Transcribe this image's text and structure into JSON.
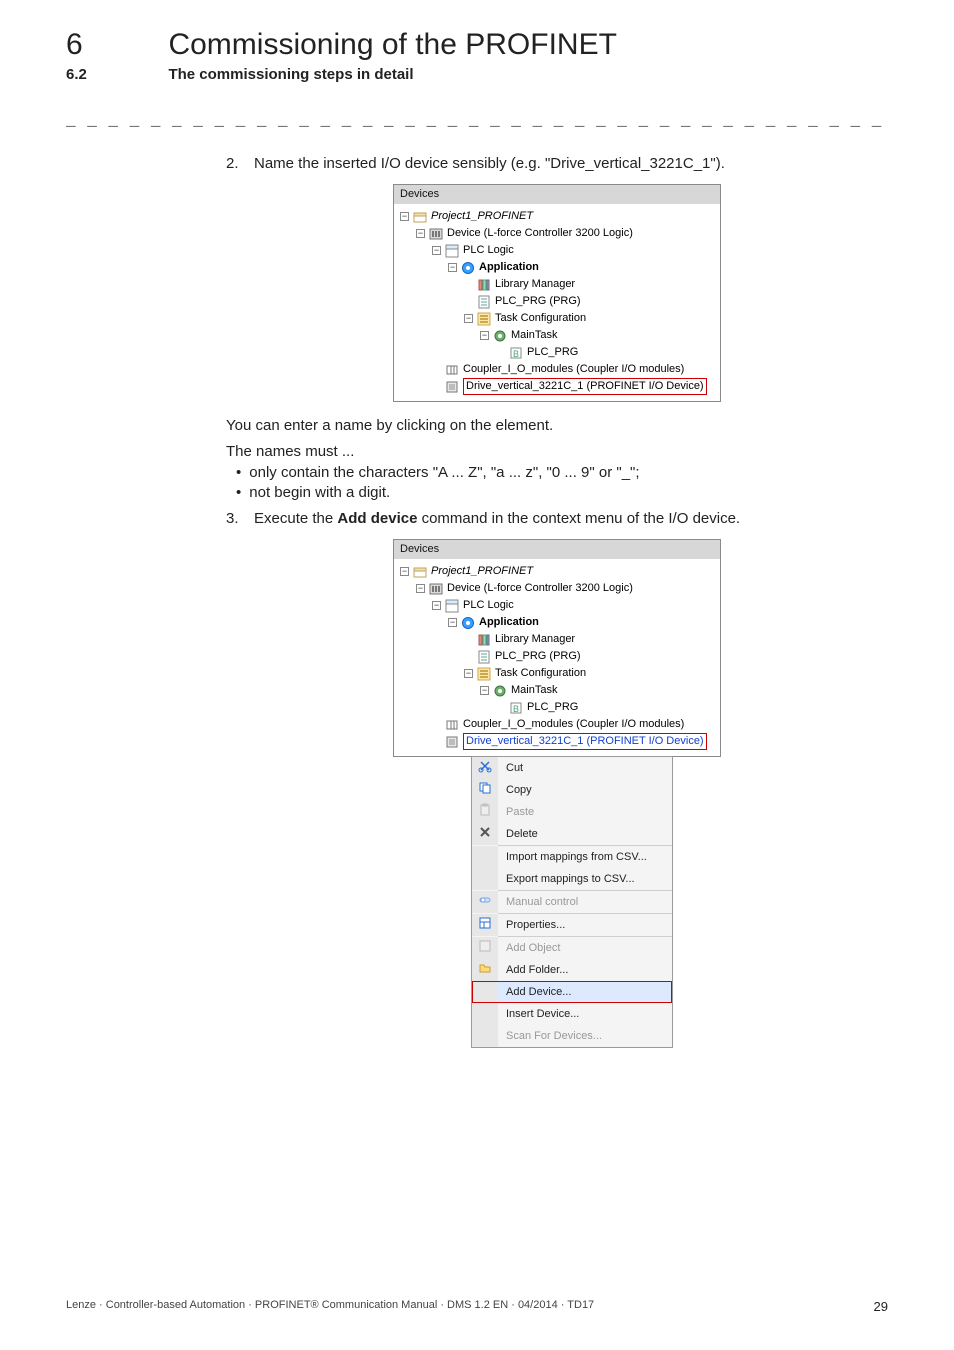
{
  "chapter": {
    "num": "6",
    "title": "Commissioning of the PROFINET"
  },
  "section": {
    "num": "6.2",
    "title": "The commissioning steps in detail"
  },
  "divider": "_ _ _ _ _ _ _ _ _ _ _ _ _ _ _ _ _ _ _ _ _ _ _ _ _ _ _ _ _ _ _ _ _ _ _ _ _ _ _ _ _ _ _ _ _ _ _ _ _ _ _ _ _ _ _ _ _ _ _ _ _ _ _ _",
  "steps": {
    "s2": {
      "num": "2.",
      "text_pre": "Name the inserted I/O device sensibly (e.g. \"Drive_vertical_3221C_1\")."
    },
    "after2_line": "You can enter a name by clicking on the element.",
    "mustline": "The names must ...",
    "bullets": {
      "b1": "only contain the characters \"A ... Z\", \"a ... z\", \"0 ... 9\" or \"_\";",
      "b2": "not begin with a digit."
    },
    "s3": {
      "num": "3.",
      "pre": "Execute the ",
      "bold": "Add device",
      "post": " command in the context menu of the I/O device."
    }
  },
  "tree": {
    "title": "Devices",
    "root": "Project1_PROFINET",
    "device": "Device (L-force Controller 3200 Logic)",
    "plc": "PLC Logic",
    "app": "Application",
    "lib": "Library Manager",
    "prg": "PLC_PRG (PRG)",
    "task": "Task Configuration",
    "mtask": "MainTask",
    "prg2": "PLC_PRG",
    "coupler": "Coupler_I_O_modules (Coupler I/O modules)",
    "drive": "Drive_vertical_3221C_1 (PROFINET I/O Device)"
  },
  "ctx": {
    "cut": "Cut",
    "copy": "Copy",
    "paste": "Paste",
    "delete": "Delete",
    "imp": "Import mappings from CSV...",
    "exp": "Export mappings to CSV...",
    "manual": "Manual control",
    "props": "Properties...",
    "addobj": "Add Object",
    "addfolder": "Add Folder...",
    "adddev": "Add Device...",
    "insdev": "Insert Device...",
    "scan": "Scan For Devices..."
  },
  "footer": {
    "left": "Lenze · Controller-based Automation · PROFINET® Communication Manual · DMS 1.2 EN · 04/2014 · TD17",
    "page": "29"
  }
}
